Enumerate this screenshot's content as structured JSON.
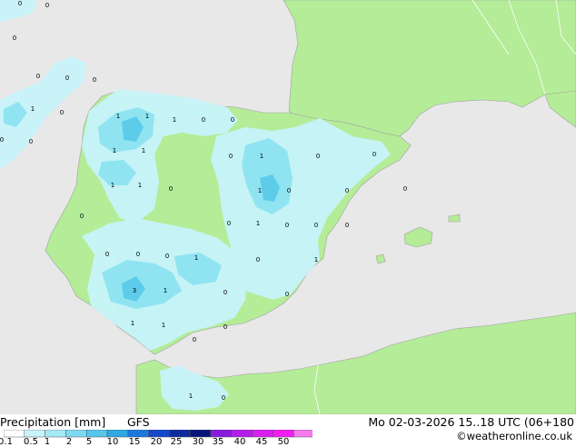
{
  "map": {
    "colors": {
      "sea": "#e8e8e8",
      "land": "#b4ec98",
      "precip_light": "#c8f4fa",
      "precip_mid": "#90e4f2",
      "precip_heavy": "#5cccea",
      "coast": "#a0a0a0",
      "border": "#ffffff"
    },
    "point_labels": [
      {
        "text": "0"
      },
      {
        "text": "0"
      },
      {
        "text": "0"
      },
      {
        "text": "0"
      },
      {
        "text": "0"
      },
      {
        "text": "0"
      },
      {
        "text": "1"
      },
      {
        "text": "0"
      },
      {
        "text": "0"
      },
      {
        "text": "1"
      },
      {
        "text": "1"
      },
      {
        "text": "1"
      },
      {
        "text": "0"
      },
      {
        "text": "0"
      },
      {
        "text": "1"
      },
      {
        "text": "1"
      },
      {
        "text": "0"
      },
      {
        "text": "1"
      },
      {
        "text": "0"
      },
      {
        "text": "0"
      },
      {
        "text": "1"
      },
      {
        "text": "1"
      },
      {
        "text": "0"
      },
      {
        "text": "1"
      },
      {
        "text": "0"
      },
      {
        "text": "0"
      },
      {
        "text": "0"
      },
      {
        "text": "0"
      },
      {
        "text": "1"
      },
      {
        "text": "0"
      },
      {
        "text": "0"
      },
      {
        "text": "0"
      },
      {
        "text": "0"
      },
      {
        "text": "0"
      },
      {
        "text": "0"
      },
      {
        "text": "0"
      },
      {
        "text": "1"
      },
      {
        "text": "0"
      },
      {
        "text": "0"
      },
      {
        "text": "1"
      },
      {
        "text": "3"
      },
      {
        "text": "1"
      },
      {
        "text": "0"
      },
      {
        "text": "0"
      },
      {
        "text": "1"
      },
      {
        "text": "1"
      },
      {
        "text": "0"
      },
      {
        "text": "0"
      },
      {
        "text": "1"
      },
      {
        "text": "0"
      }
    ]
  },
  "footer": {
    "title": "Precipitation [mm]",
    "model": "GFS",
    "datetime": "Mo 02-03-2026 15..18 UTC (06+180",
    "credit": "©weatheronline.co.uk",
    "scale": {
      "colors": [
        "#ffffff",
        "#c8f4fa",
        "#a6eaf6",
        "#7edaf0",
        "#56c6ea",
        "#2fa8e4",
        "#1b78e0",
        "#1448c8",
        "#0c2a9c",
        "#06147a",
        "#8a1adf",
        "#b21ee8",
        "#d81ef0",
        "#f01ef0",
        "#f47aee"
      ],
      "ticks": [
        "0.1",
        "0.5",
        "1",
        "2",
        "5",
        "10",
        "15",
        "20",
        "25",
        "30",
        "35",
        "40",
        "45",
        "50"
      ]
    }
  }
}
